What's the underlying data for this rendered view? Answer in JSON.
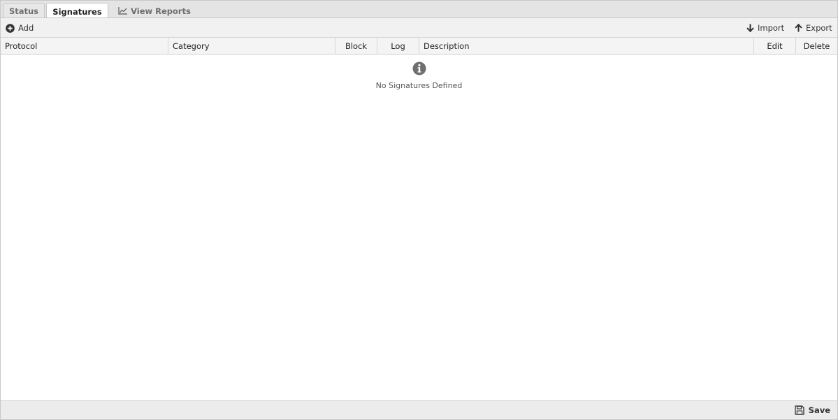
{
  "tabs": [
    {
      "label": "Status"
    },
    {
      "label": "Signatures"
    },
    {
      "label": "View Reports",
      "icon": "line-chart-icon"
    }
  ],
  "toolbar": {
    "add_label": "Add",
    "import_label": "Import",
    "export_label": "Export"
  },
  "grid": {
    "columns": [
      "Protocol",
      "Category",
      "Block",
      "Log",
      "Description",
      "Edit",
      "Delete"
    ],
    "empty_message": "No Signatures Defined"
  },
  "footer": {
    "save_label": "Save"
  },
  "colors": {
    "tab_bar": "#e4e4e4",
    "toolbar": "#f1f1f1",
    "footer": "#ececec",
    "icon": "#6f6f6f"
  }
}
